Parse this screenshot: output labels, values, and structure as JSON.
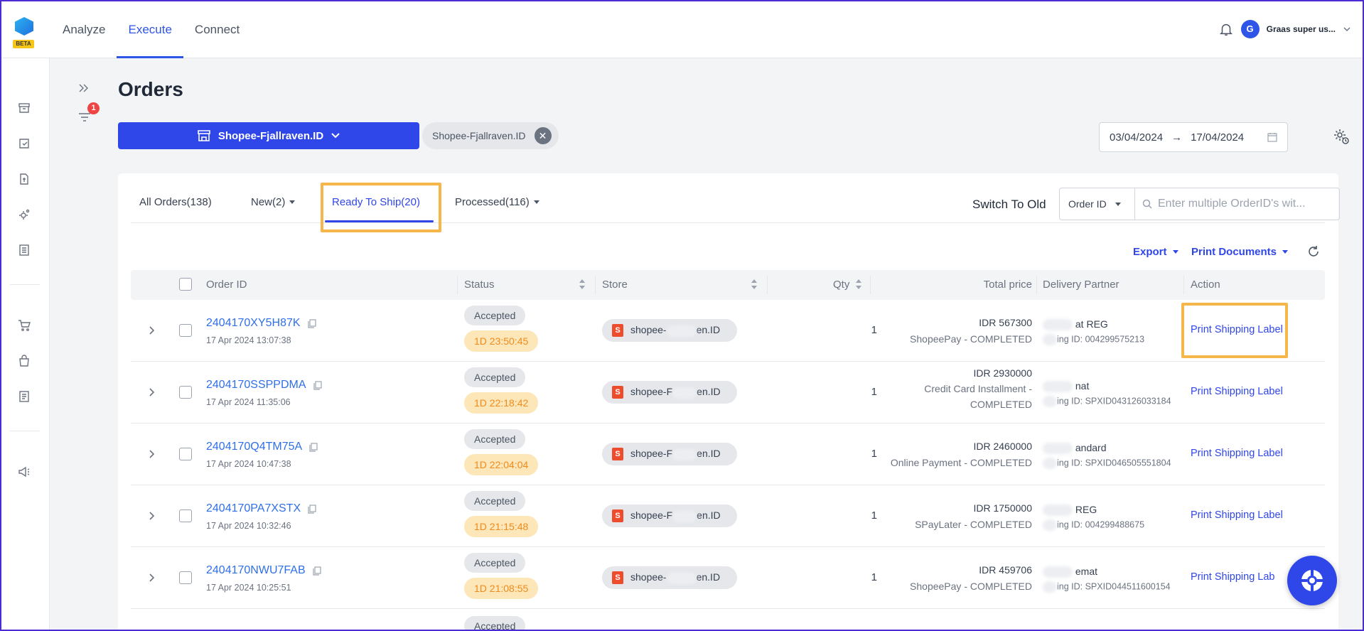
{
  "app": {
    "logo_badge": "BETA"
  },
  "topnav": {
    "items": [
      {
        "label": "Analyze"
      },
      {
        "label": "Execute"
      },
      {
        "label": "Connect"
      }
    ],
    "active": "Execute",
    "user_initial": "G",
    "user_name": "Graas super us..."
  },
  "subcol": {
    "filter_badge": "1"
  },
  "page": {
    "title": "Orders",
    "store_button": "Shopee-Fjallraven.ID",
    "store_chip": "Shopee-Fjallraven.ID",
    "date_from": "03/04/2024",
    "date_arrow": "→",
    "date_to": "17/04/2024"
  },
  "tabs": {
    "all": "All Orders(138)",
    "new": "New(2)",
    "ready": "Ready To Ship(20)",
    "processed": "Processed(116)",
    "switch_old": "Switch To Old",
    "search_type": "Order ID",
    "search_placeholder": "Enter multiple OrderID's wit..."
  },
  "actions": {
    "export": "Export",
    "print_documents": "Print Documents"
  },
  "table": {
    "headers": {
      "order_id": "Order ID",
      "status": "Status",
      "store": "Store",
      "qty": "Qty",
      "total_price": "Total price",
      "delivery": "Delivery Partner",
      "action": "Action"
    },
    "rows": [
      {
        "order_id": "2404170XY5H87K",
        "date": "17 Apr 2024 13:07:38",
        "status": "Accepted",
        "timer": "1D 23:50:45",
        "store_prefix": "shopee-",
        "store_suffix": "en.ID",
        "qty": "1",
        "price": "IDR 567300",
        "payment": "ShopeePay - COMPLETED",
        "partner": "at REG",
        "tracking": "ing ID: 004299575213",
        "action": "Print Shipping Label"
      },
      {
        "order_id": "2404170SSPPDMA",
        "date": "17 Apr 2024 11:35:06",
        "status": "Accepted",
        "timer": "1D 22:18:42",
        "store_prefix": "shopee-F",
        "store_suffix": "en.ID",
        "qty": "1",
        "price": "IDR 2930000",
        "payment": "Credit Card Installment - COMPLETED",
        "partner": "nat",
        "tracking": "ing ID: SPXID043126033184",
        "action": "Print Shipping Label"
      },
      {
        "order_id": "2404170Q4TM75A",
        "date": "17 Apr 2024 10:47:38",
        "status": "Accepted",
        "timer": "1D 22:04:04",
        "store_prefix": "shopee-F",
        "store_suffix": "en.ID",
        "qty": "1",
        "price": "IDR 2460000",
        "payment": "Online Payment - COMPLETED",
        "partner": "andard",
        "tracking": "ing ID: SPXID046505551804",
        "action": "Print Shipping Label"
      },
      {
        "order_id": "2404170PA7XSTX",
        "date": "17 Apr 2024 10:32:46",
        "status": "Accepted",
        "timer": "1D 21:15:48",
        "store_prefix": "shopee-F",
        "store_suffix": "en.ID",
        "qty": "1",
        "price": "IDR 1750000",
        "payment": "SPayLater - COMPLETED",
        "partner": "REG",
        "tracking": "ing ID: 004299488675",
        "action": "Print Shipping Label"
      },
      {
        "order_id": "2404170NWU7FAB",
        "date": "17 Apr 2024 10:25:51",
        "status": "Accepted",
        "timer": "1D 21:08:55",
        "store_prefix": "shopee-",
        "store_suffix": "en.ID",
        "qty": "1",
        "price": "IDR 459706",
        "payment": "ShopeePay - COMPLETED",
        "partner": "emat",
        "tracking": "ing ID: SPXID044511600154",
        "action": "Print Shipping Lab"
      }
    ],
    "partial_status": "Accepted"
  },
  "colors": {
    "accent": "#2f46e8",
    "highlight": "#f5b74a",
    "timer_bg": "#fde7b8",
    "timer_text": "#f08a1c"
  }
}
